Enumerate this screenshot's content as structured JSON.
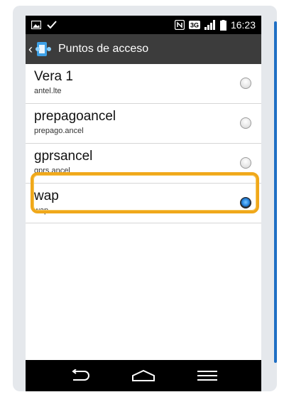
{
  "status_bar": {
    "time": "16:23",
    "network_badge": "3G",
    "icons": [
      "picture-icon",
      "check-icon",
      "nfc-icon",
      "network-3g-icon",
      "signal-icon",
      "battery-icon"
    ]
  },
  "action_bar": {
    "title": "Puntos de acceso",
    "back_glyph": "‹",
    "icon": "apn-app-icon"
  },
  "apn_list": [
    {
      "name": "Vera 1",
      "apn": "antel.lte",
      "selected": false
    },
    {
      "name": "prepagoancel",
      "apn": "prepago.ancel",
      "selected": false
    },
    {
      "name": "gprsancel",
      "apn": "gprs.ancel",
      "selected": false
    },
    {
      "name": "wap",
      "apn": "wap",
      "selected": true
    }
  ],
  "nav_bar": {
    "icons": [
      "back-icon",
      "home-icon",
      "menu-icon"
    ]
  },
  "colors": {
    "highlight": "#f0a81a",
    "action_bar": "#3c3c3c",
    "frame": "#e5e8ec",
    "accent_edge": "#1f6fc4",
    "radio_selected": "#2f8fe6"
  }
}
